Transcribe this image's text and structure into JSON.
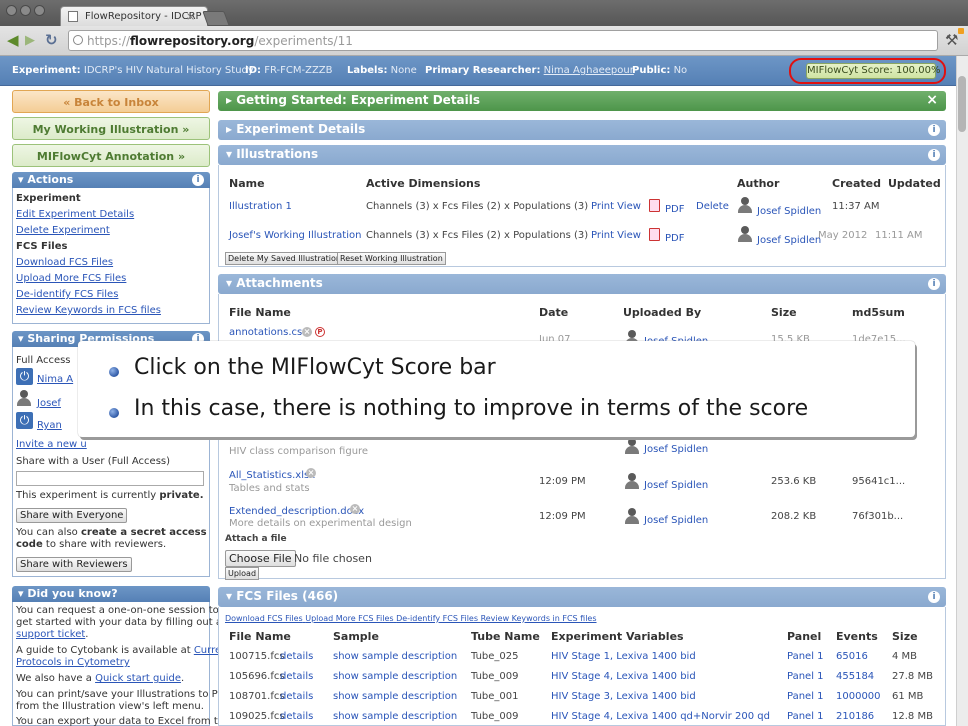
{
  "browser": {
    "tab_title": "FlowRepository - IDCRP",
    "tab_close": "×",
    "url_prefix": "https://",
    "url_domain": "flowrepository.org",
    "url_path": "/experiments/11",
    "back_icon": "back-arrow-icon",
    "forward_icon": "forward-arrow-icon",
    "reload_icon": "reload-icon",
    "wrench_icon": "wrench-icon"
  },
  "experiment_header": {
    "experiment_label": "Experiment:",
    "experiment_value": "IDCRP's HIV Natural History Study",
    "id_label": "ID:",
    "id_value": "FR-FCM-ZZZB",
    "labels_label": "Labels:",
    "labels_value": "None",
    "researcher_label": "Primary Researcher:",
    "researcher_value": "Nima Aghaeepour",
    "public_label": "Public:",
    "public_value": "No",
    "score": "MIFlowCyt Score: 100.00%"
  },
  "sidebar": {
    "back_to_inbox": "« Back to Inbox",
    "my_working_illustration": "My Working Illustration »",
    "miflowcyt_annotation": "MIFlowCyt Annotation »",
    "actions": {
      "title": "▾ Actions",
      "experiment_heading": "Experiment",
      "edit_experiment": "Edit Experiment Details",
      "delete_experiment": "Delete Experiment",
      "fcs_heading": "FCS Files",
      "download_fcs": "Download FCS Files",
      "upload_fcs": "Upload More FCS Files",
      "deidentify_fcs": "De-identify FCS Files",
      "review_keywords": "Review Keywords in FCS files"
    },
    "sharing": {
      "title": "▾ Sharing Permissions",
      "full_access": "Full Access",
      "user1": "Nima A",
      "user2": "Josef",
      "user3": "Ryan",
      "invite": "Invite a new u",
      "share_with_user": "Share with a User (Full Access)",
      "private_prefix": "This experiment is currently ",
      "private_word": "private.",
      "share_everyone": "Share with Everyone",
      "secret_line1_a": "You can also ",
      "secret_line1_b": "create a secret access",
      "secret_line2_a": "code",
      "secret_line2_b": " to share with reviewers.",
      "share_reviewers": "Share with Reviewers"
    },
    "did_you_know": {
      "title": "▾ Did you know?",
      "l1": "You can request a one-on-one session to",
      "l2": "get started with your data by filling out a",
      "l3": "support ticket",
      "l3_end": ".",
      "l4": "A guide to Cytobank is available at ",
      "l4_link": "Current",
      "l5": "Protocols in Cytometry",
      "l6": "We also have a ",
      "l6_link": "Quick start guide",
      "l6_end": ".",
      "l7": "You can print/save your Illustrations to PDF",
      "l8": "from the Illustration view's left menu.",
      "l9": "You can export your data to Excel from the"
    }
  },
  "panels": {
    "getting_started": "▸ Getting Started: Experiment Details",
    "getting_started_close": "×",
    "experiment_details": "▸ Experiment Details",
    "illustrations": {
      "title": "▾ Illustrations",
      "headers": [
        "Name",
        "Active Dimensions",
        "Author",
        "Created",
        "Updated"
      ],
      "rows": [
        {
          "name": "Illustration 1",
          "dims": "Channels (3) x Fcs Files (2) x Populations (3)",
          "print": "Print View",
          "pdf": "PDF",
          "delete": "Delete",
          "author": "Josef Spidlen",
          "created": "11:37 AM",
          "updated": ""
        },
        {
          "name": "Josef's Working Illustration",
          "dims": "Channels (3) x Fcs Files (2) x Populations (3)",
          "print": "Print View",
          "pdf": "PDF",
          "delete": "",
          "author": "Josef Spidlen",
          "created": "May 2012",
          "updated": "11:11 AM"
        }
      ],
      "delete_saved": "Delete My Saved Illustrations",
      "reset_working": "Reset Working Illustration"
    },
    "attachments": {
      "title": "▾ Attachments",
      "headers": [
        "File Name",
        "Date",
        "Uploaded By",
        "Size",
        "md5sum"
      ],
      "rows": [
        {
          "name": "annotations.csv",
          "desc": "",
          "date": "Jun 07",
          "by": "Josef Spidlen",
          "size": "15.5 KB",
          "md5": "1de7e15..."
        },
        {
          "name": "",
          "desc": "HIV class comparison figure",
          "date": "",
          "by": "Josef Spidlen",
          "size": "",
          "md5": ""
        },
        {
          "name": "All_Statistics.xlsx",
          "desc": "Tables and stats",
          "date": "12:09 PM",
          "by": "Josef Spidlen",
          "size": "253.6 KB",
          "md5": "95641c1..."
        },
        {
          "name": "Extended_description.docx",
          "desc": "More details on experimental design",
          "date": "12:09 PM",
          "by": "Josef Spidlen",
          "size": "208.2 KB",
          "md5": "76f301b..."
        }
      ],
      "attach_label": "Attach a file",
      "choose_file": "Choose File",
      "no_file": "No file chosen",
      "upload": "Upload"
    },
    "fcs_files": {
      "title": "▾ FCS Files (466)",
      "links": [
        "Download FCS Files",
        "Upload More FCS Files",
        "De-identify FCS Files",
        "Review Keywords in FCS files"
      ],
      "headers": [
        "File Name",
        "Sample",
        "Tube Name",
        "Experiment Variables",
        "Panel",
        "Events",
        "Size"
      ],
      "rows": [
        {
          "file": "100715.fcs",
          "details": "details",
          "sample": "show sample description",
          "tube": "Tube_025",
          "vars": "HIV Stage 1, Lexiva 1400 bid",
          "panel": "Panel 1",
          "events": "65016",
          "size": "4 MB"
        },
        {
          "file": "105696.fcs",
          "details": "details",
          "sample": "show sample description",
          "tube": "Tube_009",
          "vars": "HIV Stage 4, Lexiva 1400 bid",
          "panel": "Panel 1",
          "events": "455184",
          "size": "27.8 MB"
        },
        {
          "file": "108701.fcs",
          "details": "details",
          "sample": "show sample description",
          "tube": "Tube_001",
          "vars": "HIV Stage 3, Lexiva 1400 bid",
          "panel": "Panel 1",
          "events": "1000000",
          "size": "61 MB"
        },
        {
          "file": "109025.fcs",
          "details": "details",
          "sample": "show sample description",
          "tube": "Tube_009",
          "vars": "HIV Stage 4, Lexiva 1400 qd+Norvir 200 qd",
          "panel": "Panel 1",
          "events": "210186",
          "size": "12.8 MB"
        }
      ]
    }
  },
  "overlay": {
    "bullet1": "Click on the MIFlowCyt Score bar",
    "bullet2": "In this case, there is nothing to improve in terms of the score"
  }
}
